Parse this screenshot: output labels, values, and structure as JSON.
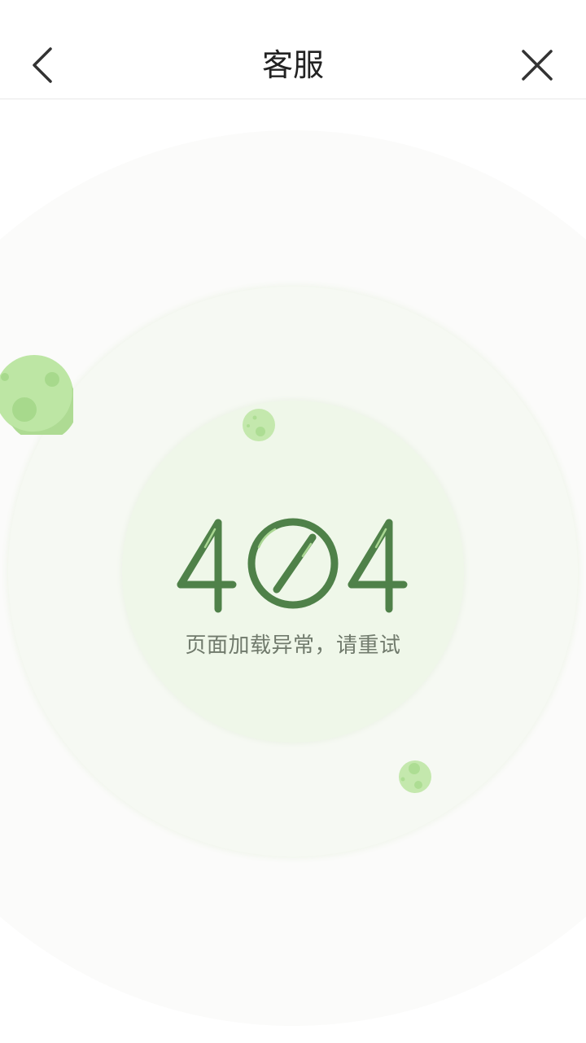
{
  "header": {
    "title": "客服",
    "back_icon": "chevron-left-icon",
    "close_icon": "close-icon"
  },
  "error": {
    "code": "404",
    "message": "页面加载异常，请重试"
  },
  "colors": {
    "digit_green": "#4f8149",
    "planet_green": "#bde6a4",
    "planet_spot": "#a8da8c",
    "message_gray": "#707a6c",
    "ring_outer": "#fbfbfa",
    "ring_mid": "#f6f9f3",
    "ring_inner": "#eff7e9"
  }
}
